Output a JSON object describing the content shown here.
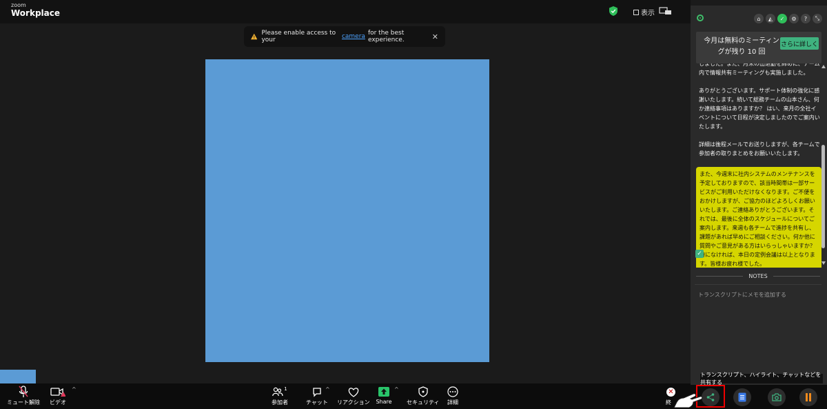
{
  "app": {
    "logo_small": "zoom",
    "logo_big": "Workplace"
  },
  "topbar": {
    "view_label": "表示"
  },
  "notification": {
    "text_before": "Please enable access to your",
    "link": "camera",
    "text_after": "for the best experience.",
    "close": "✕"
  },
  "toolbar": {
    "mute": "ミュート解除",
    "video": "ビデオ",
    "participants": "参加者",
    "participants_count": "1",
    "chat": "チャット",
    "reactions": "リアクション",
    "share": "Share",
    "security": "セキュリティ",
    "more": "詳細",
    "end": "終"
  },
  "panel": {
    "promo_text": "今月は無料のミーティングが残り 10 回",
    "promo_button": "さらに詳しく",
    "transcript": [
      "しました。また、月末の出退勤を締めに、チーム内で情報共有ミーティングも実施しました。",
      "ありがとうございます。サポート体制の強化に感謝いたします。続いて総務チームの山本さん、何か連絡事項はありますか？ はい、来月の全社イベントについて日程が決定しましたのでご案内いたします。",
      "詳細は後程メールでお送りしますが、各チームで参加者の取りまとめをお願いいたします。"
    ],
    "highlight": "また、今週末に社内システムのメンテナンスを予定しておりますので、該当時間帯は一部サービスがご利用いただけなくなります。ご不便をおかけしますが、ご協力のほどよろしくお願いいたします。ご連絡ありがとうございます。それでは、最後に全体のスケジュールについてご案内します。来週も各チームで進捗を共有し、課題があれば早めにご相談ください。何か他に質問やご意見がある方はいらっしゃいますか？ 特になければ、本日の定例会議は以上となります。皆様お疲れ様でした。",
    "notes_title": "NOTES",
    "notes_placeholder": "トランスクリプトにメモを追加する",
    "tooltip": "トランスクリプト、ハイライト、チャットなどを共有する"
  },
  "colors": {
    "accent": "#3fb27f",
    "highlight": "#d6d600",
    "stage": "#5b9bd5",
    "red_box": "#ee0000"
  }
}
